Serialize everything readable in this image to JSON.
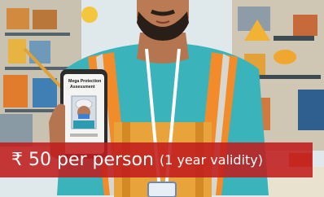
{
  "image": {
    "id_card_text": [
      "Mega Protection",
      "Assessment"
    ],
    "price_text": "₹ 50 per person",
    "validity_text": "(1 year validity)"
  }
}
